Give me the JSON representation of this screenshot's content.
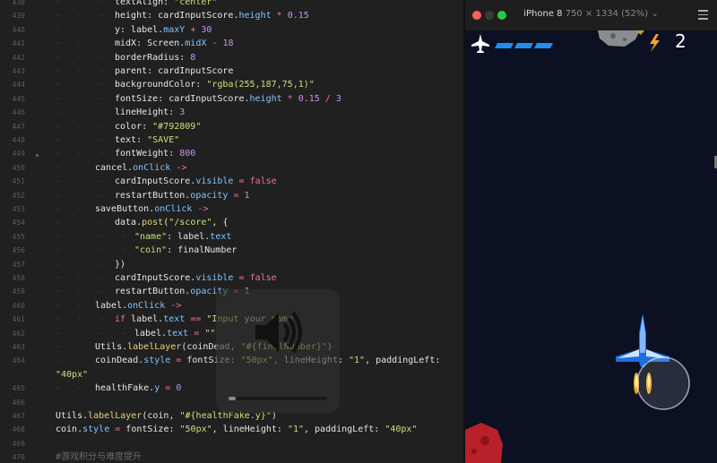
{
  "editor": {
    "lines": [
      {
        "n": "438",
        "indent": 4,
        "html": "textAlign: <span class='str'>\"center\"</span>"
      },
      {
        "n": "439",
        "indent": 4,
        "html": "height: cardInputScore.<span class='prop'>height</span> <span class='kw'>*</span> <span class='num'>0.15</span>"
      },
      {
        "n": "440",
        "indent": 4,
        "html": "y: label.<span class='prop'>maxY</span> <span class='kw'>+</span> <span class='num'>30</span>"
      },
      {
        "n": "441",
        "indent": 4,
        "html": "midX: Screen.<span class='prop'>midX</span> <span class='kw'>-</span> <span class='num'>18</span>"
      },
      {
        "n": "442",
        "indent": 4,
        "html": "borderRadius: <span class='num'>8</span>"
      },
      {
        "n": "443",
        "indent": 4,
        "html": "parent: cardInputScore"
      },
      {
        "n": "444",
        "indent": 4,
        "html": "backgroundColor: <span class='str'>\"rgba(255,187,75,1)\"</span>"
      },
      {
        "n": "445",
        "indent": 4,
        "html": "fontSize: cardInputScore.<span class='prop'>height</span> <span class='kw'>*</span> <span class='num'>0.15</span> <span class='kw'>/</span> <span class='num'>3</span>"
      },
      {
        "n": "446",
        "indent": 4,
        "html": "lineHeight: <span class='num'>3</span>"
      },
      {
        "n": "447",
        "indent": 4,
        "html": "color: <span class='str'>\"#792809\"</span>"
      },
      {
        "n": "448",
        "indent": 4,
        "html": "text: <span class='str'>\"SAVE\"</span>"
      },
      {
        "n": "449",
        "indent": 4,
        "html": "fontWeight: <span class='num'>800</span>"
      },
      {
        "n": "450",
        "indent": 3,
        "html": "cancel.<span class='prop'>onClick</span> <span class='kw'>-&gt;</span>"
      },
      {
        "n": "451",
        "indent": 4,
        "html": "cardInputScore.<span class='prop'>visible</span> <span class='kw'>=</span> <span class='kw'>false</span>"
      },
      {
        "n": "452",
        "indent": 4,
        "html": "restartButton.<span class='prop'>opacity</span> <span class='kw'>=</span> <span class='num'>1</span>"
      },
      {
        "n": "453",
        "indent": 3,
        "html": "saveButton.<span class='prop'>onClick</span> <span class='kw'>-&gt;</span>"
      },
      {
        "n": "454",
        "indent": 4,
        "html": "data.<span class='fn'>post</span>(<span class='str'>\"/score\"</span>, {"
      },
      {
        "n": "455",
        "indent": 5,
        "html": "<span class='str'>\"name\"</span>: label.<span class='prop'>text</span>"
      },
      {
        "n": "456",
        "indent": 5,
        "html": "<span class='str'>\"coin\"</span>: finalNumber"
      },
      {
        "n": "457",
        "indent": 4,
        "html": "})"
      },
      {
        "n": "458",
        "indent": 4,
        "html": "cardInputScore.<span class='prop'>visible</span> <span class='kw'>=</span> <span class='kw'>false</span>"
      },
      {
        "n": "459",
        "indent": 4,
        "html": "restartButton.<span class='prop'>opacity</span> <span class='kw'>=</span> <span class='num'>1</span>"
      },
      {
        "n": "460",
        "indent": 3,
        "html": "label.<span class='prop'>onClick</span> <span class='kw'>-&gt;</span>"
      },
      {
        "n": "461",
        "indent": 4,
        "html": "<span class='kw'>if</span> label.<span class='prop'>text</span> <span class='kw'>==</span> <span class='str'>\"Input your name\"</span>"
      },
      {
        "n": "462",
        "indent": 5,
        "html": "label.<span class='prop'>text</span> <span class='kw'>=</span> <span class='str'>\"\"</span>"
      },
      {
        "n": "463",
        "indent": 3,
        "html": "Utils.<span class='fn'>labelLayer</span>(coinDead, <span class='str'>\"#{finalNumber}\"</span>)"
      },
      {
        "n": "464",
        "indent": 3,
        "html": "coinDead.<span class='prop'>style</span> <span class='kw'>=</span> fontSize: <span class='str'>\"50px\"</span>, lineHeight: <span class='str'>\"1\"</span>, paddingLeft:"
      },
      {
        "n": "",
        "indent": 0,
        "html": "<span class='str'>\"40px\"</span>"
      },
      {
        "n": "465",
        "indent": 3,
        "html": "healthFake.<span class='prop'>y</span> <span class='kw'>=</span> <span class='num'>0</span>"
      },
      {
        "n": "466",
        "indent": 0,
        "html": ""
      },
      {
        "n": "467",
        "indent": 0,
        "html": "Utils.<span class='fn'>labelLayer</span>(coin, <span class='str'>\"#{healthFake.y}\"</span>)"
      },
      {
        "n": "468",
        "indent": 0,
        "html": "coin.<span class='prop'>style</span> <span class='kw'>=</span> fontSize: <span class='str'>\"50px\"</span>, lineHeight: <span class='str'>\"1\"</span>, paddingLeft: <span class='str'>\"40px\"</span>"
      },
      {
        "n": "469",
        "indent": 0,
        "html": ""
      },
      {
        "n": "470",
        "indent": 0,
        "html": "<span class='cmt'>#游戏积分与难度提升</span>"
      }
    ]
  },
  "preview": {
    "device_name": "iPhone 8",
    "device_size": "750 × 1334 (52%)",
    "score": "2",
    "colors": {
      "close": "#ff5f57",
      "minimize": "#3a3a3a",
      "zoom": "#28c840",
      "health": "#1e8ff0",
      "bolt": "#f5a623",
      "background": "#0b1022"
    }
  },
  "icons": {
    "menu": "hamburger-icon",
    "volume": "speaker-icon",
    "bolt": "lightning-icon"
  }
}
